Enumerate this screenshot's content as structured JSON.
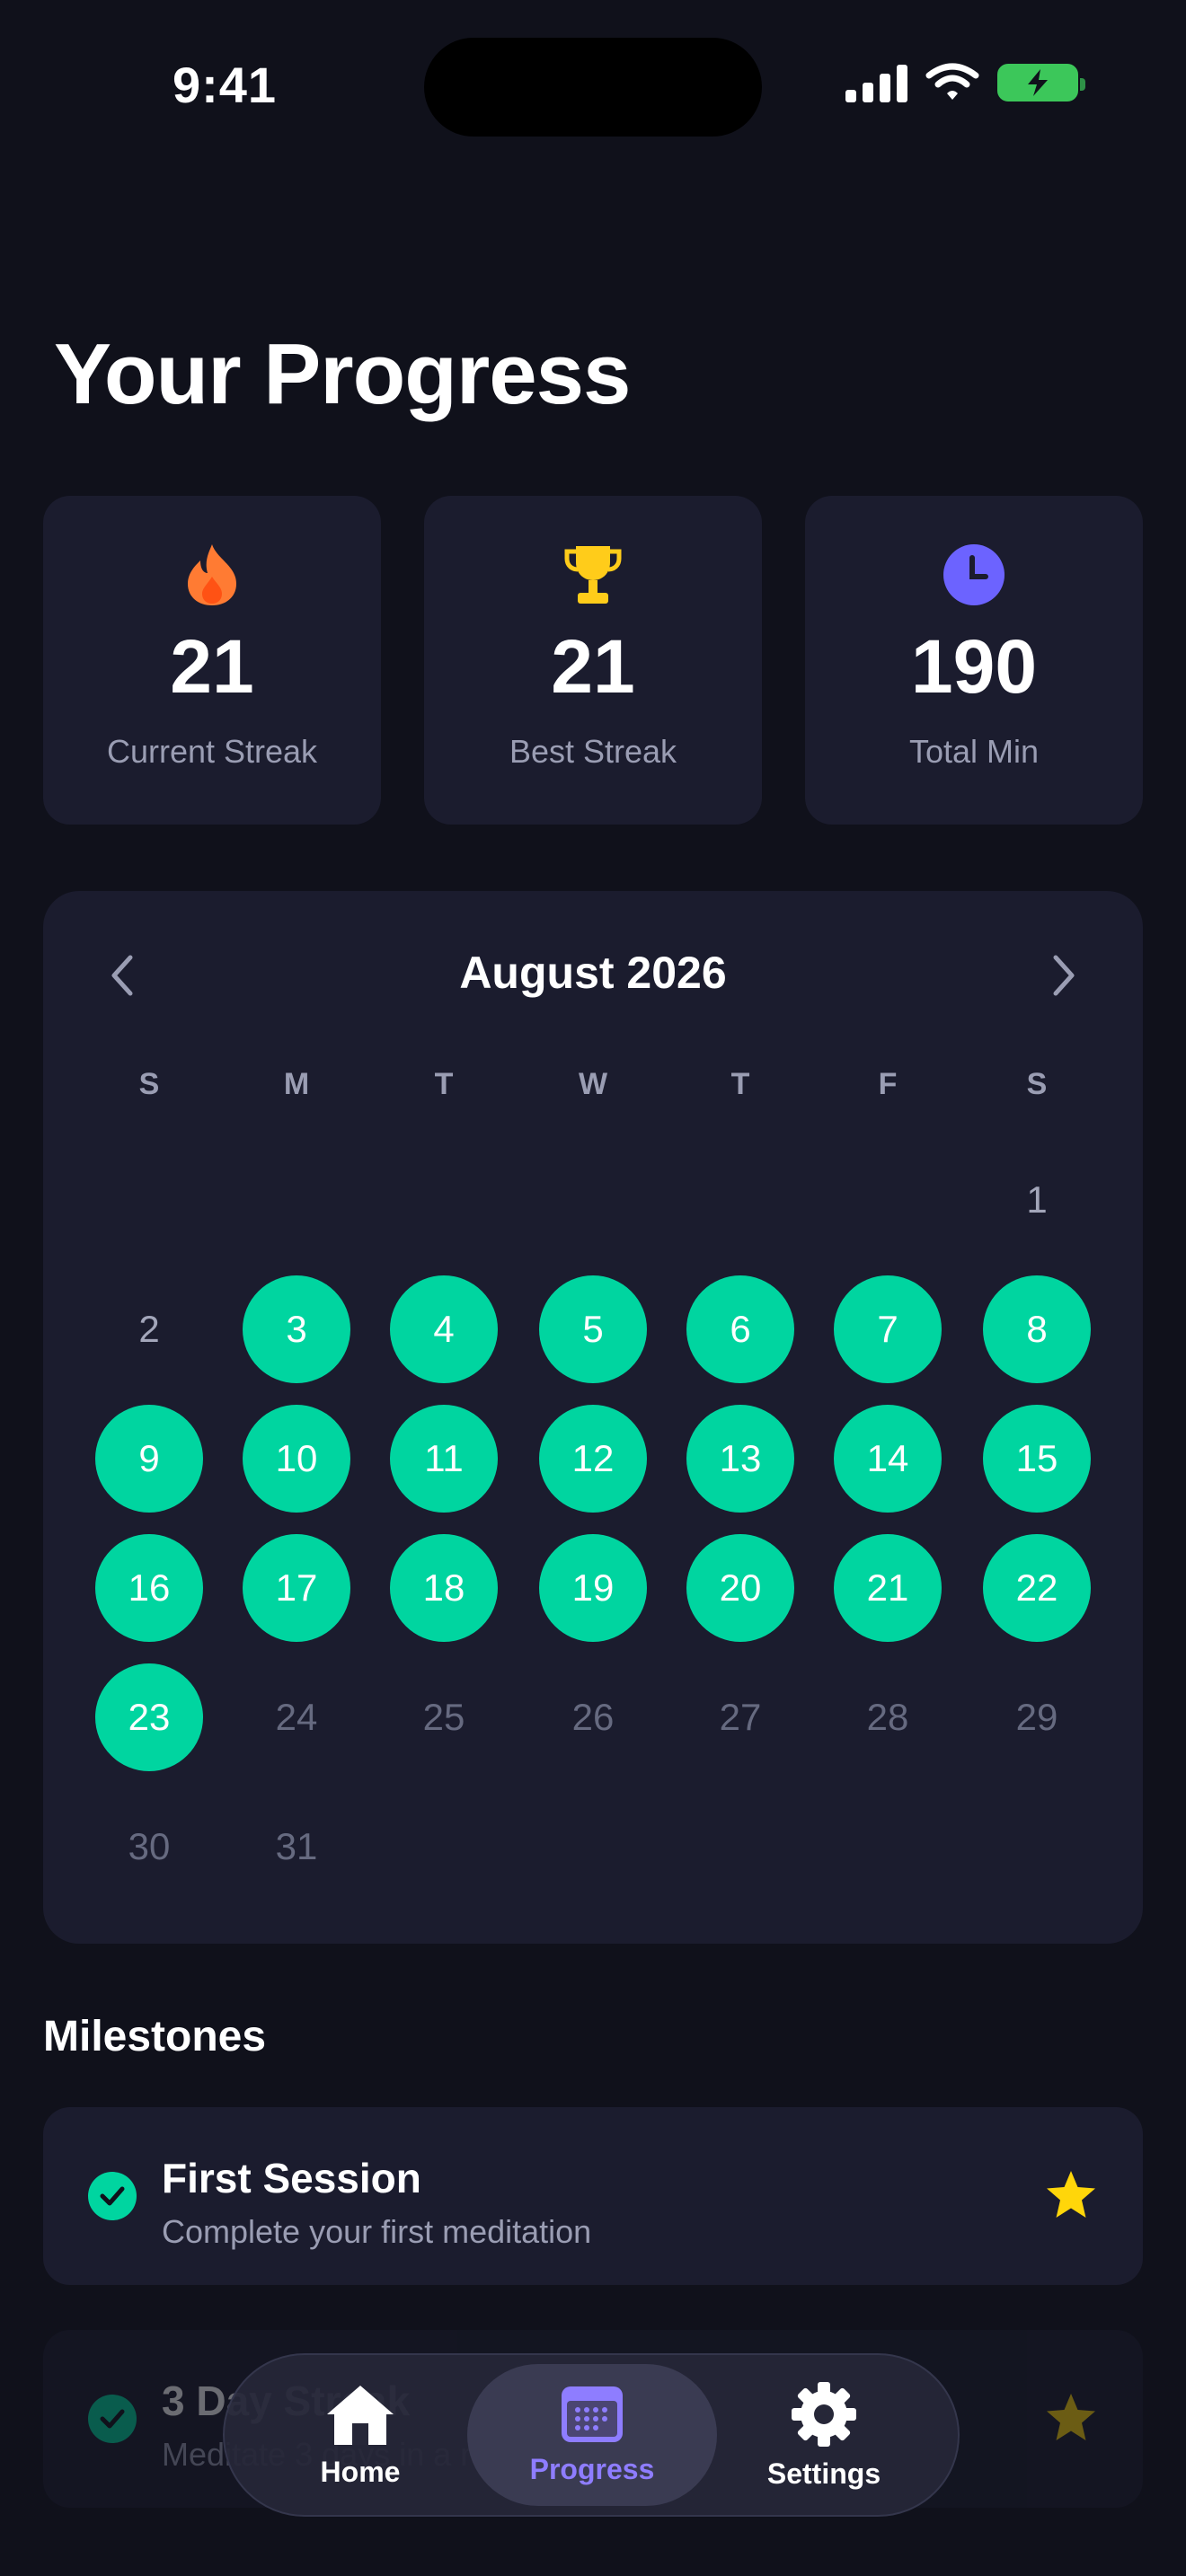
{
  "status_bar": {
    "time": "9:41"
  },
  "page": {
    "title": "Your Progress"
  },
  "stats": [
    {
      "icon": "flame-icon",
      "value": "21",
      "label": "Current Streak",
      "color": "#ff7b33"
    },
    {
      "icon": "trophy-icon",
      "value": "21",
      "label": "Best Streak",
      "color": "#ffcc1a"
    },
    {
      "icon": "clock-icon",
      "value": "190",
      "label": "Total Min",
      "color": "#6c63ff"
    }
  ],
  "calendar": {
    "month_label": "August 2026",
    "weekdays": [
      "S",
      "M",
      "T",
      "W",
      "T",
      "F",
      "S"
    ],
    "first_weekday_index": 6,
    "days_in_month": 31,
    "completed_days": [
      3,
      4,
      5,
      6,
      7,
      8,
      9,
      10,
      11,
      12,
      13,
      14,
      15,
      16,
      17,
      18,
      19,
      20,
      21,
      22,
      23
    ],
    "today": 23
  },
  "milestones": {
    "title": "Milestones",
    "items": [
      {
        "title": "First Session",
        "description": "Complete your first meditation",
        "completed": true
      },
      {
        "title": "3 Day Streak",
        "description": "Meditate 3 days in a row",
        "completed": true
      }
    ]
  },
  "tabbar": {
    "tabs": [
      {
        "label": "Home",
        "icon": "home-icon",
        "active": false
      },
      {
        "label": "Progress",
        "icon": "calendar-icon",
        "active": true
      },
      {
        "label": "Settings",
        "icon": "gear-icon",
        "active": false
      }
    ]
  },
  "colors": {
    "background": "#10111b",
    "card": "#1b1c2e",
    "accent_green": "#00d5a0",
    "accent_purple": "#8e7dff",
    "star": "#ffd60a"
  }
}
